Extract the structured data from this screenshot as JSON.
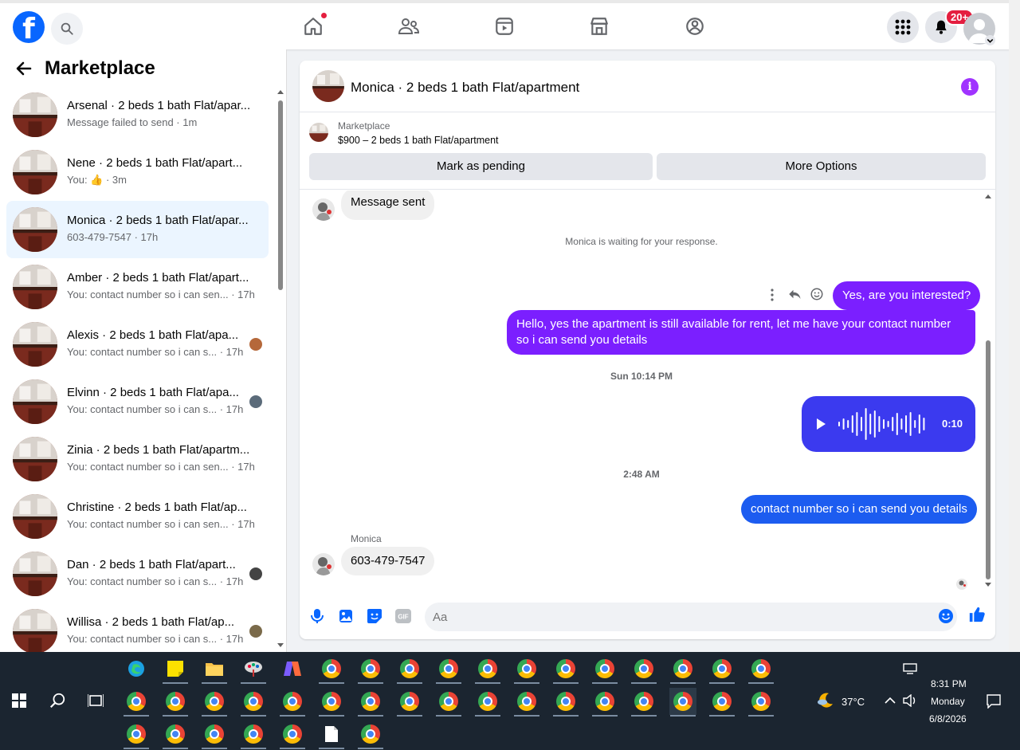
{
  "nav": {
    "search_icon": "search-icon",
    "notifications_badge": "20+"
  },
  "sidebar": {
    "title": "Marketplace",
    "conversations": [
      {
        "name": "Arsenal · 2 beds 1 bath Flat/apar...",
        "sub": "Message failed to send · 1m"
      },
      {
        "name": "Nene · 2 beds 1 bath Flat/apart...",
        "sub": "You: 👍 · 3m"
      },
      {
        "name": "Monica · 2 beds 1 bath Flat/apar...",
        "sub": "603-479-7547 · 17h"
      },
      {
        "name": "Amber · 2 beds 1 bath Flat/apart...",
        "sub": "You: contact number so i can sen...  · 17h"
      },
      {
        "name": "Alexis · 2 beds 1 bath Flat/apa...",
        "sub": "You: contact number so i can s...  · 17h"
      },
      {
        "name": "Elvinn · 2 beds 1 bath Flat/apa...",
        "sub": "You: contact number so i can s...  · 17h"
      },
      {
        "name": "Zinia · 2 beds 1 bath Flat/apartm...",
        "sub": "You: contact number so i can sen...  · 17h"
      },
      {
        "name": "Christine · 2 beds 1 bath Flat/ap...",
        "sub": "You: contact number so i can sen...  · 17h"
      },
      {
        "name": "Dan · 2 beds 1 bath Flat/apart...",
        "sub": "You: contact number so i can s...  · 17h"
      },
      {
        "name": "Willisa · 2 beds 1 bath Flat/ap...",
        "sub": "You: contact number so i can s...  · 17h"
      }
    ]
  },
  "chat": {
    "title": "Monica · 2 beds 1 bath Flat/apartment",
    "marketplace_label": "Marketplace",
    "listing": "$900 – 2 beds 1 bath Flat/apartment",
    "mark_pending": "Mark as pending",
    "more_options": "More Options",
    "messages": {
      "m1": "Message sent",
      "waiting": "Monica is waiting for your response.",
      "m2": "Yes, are you interested?",
      "m3": "Hello, yes the apartment is still available for rent, let me have your contact number so i can send you details",
      "ts1": "Sun 10:14 PM",
      "voice_duration": "0:10",
      "ts2": "2:48 AM",
      "m4": "contact number so i can send you details",
      "sender": "Monica",
      "m5": "603-479-7547"
    },
    "composer_placeholder": "Aa"
  },
  "taskbar": {
    "weather": "37°C",
    "time": "8:31 PM",
    "day": "Monday",
    "date": "6/8/2026"
  }
}
